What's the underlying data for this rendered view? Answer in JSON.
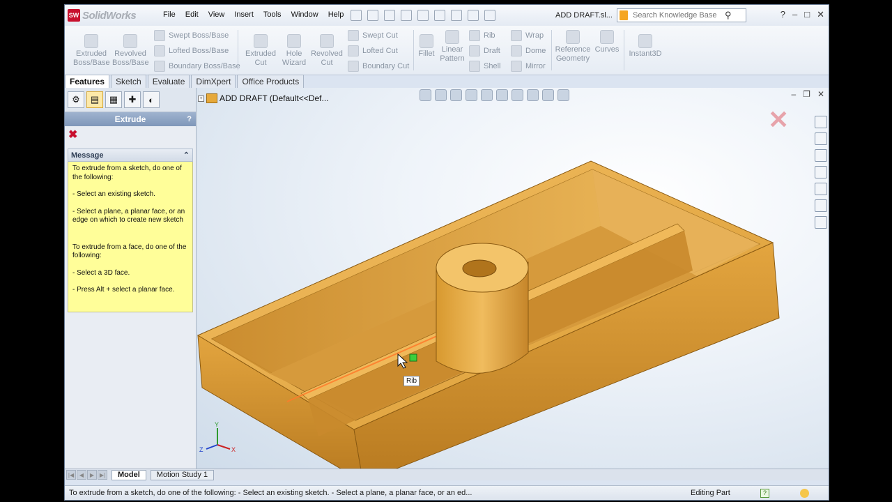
{
  "app": {
    "name": "SolidWorks",
    "badge": "SW"
  },
  "menu": [
    "File",
    "Edit",
    "View",
    "Insert",
    "Tools",
    "Window",
    "Help"
  ],
  "doc_title": "ADD DRAFT.sl...",
  "search": {
    "placeholder": "Search Knowledge Base"
  },
  "ribbon": {
    "extruded_boss": "Extruded Boss/Base",
    "revolved_boss": "Revolved Boss/Base",
    "swept_boss": "Swept Boss/Base",
    "lofted_boss": "Lofted Boss/Base",
    "boundary_boss": "Boundary Boss/Base",
    "extruded_cut": "Extruded Cut",
    "hole_wizard": "Hole Wizard",
    "revolved_cut": "Revolved Cut",
    "swept_cut": "Swept Cut",
    "lofted_cut": "Lofted Cut",
    "boundary_cut": "Boundary Cut",
    "fillet": "Fillet",
    "linear_pattern": "Linear Pattern",
    "rib": "Rib",
    "draft": "Draft",
    "shell": "Shell",
    "wrap": "Wrap",
    "dome": "Dome",
    "mirror": "Mirror",
    "reference_geometry": "Reference Geometry",
    "curves": "Curves",
    "instant3d": "Instant3D"
  },
  "tabs": [
    "Features",
    "Sketch",
    "Evaluate",
    "DimXpert",
    "Office Products"
  ],
  "property_manager": {
    "title": "Extrude",
    "help": "?",
    "message_header": "Message",
    "message_lines": [
      "To extrude from a sketch, do one of the following:",
      "- Select an existing sketch.",
      "- Select a plane, a planar face, or an edge on which to create new sketch",
      "To extrude from a face, do one of the following:",
      "- Select a 3D face.",
      "- Press Alt + select a planar face."
    ]
  },
  "feature_tree": {
    "root": "ADD DRAFT  (Default<<Def..."
  },
  "tooltip": "Rib",
  "triad": {
    "y": "Y",
    "z": "Z",
    "x": "X"
  },
  "bottom_tabs": [
    "Model",
    "Motion Study 1"
  ],
  "status": {
    "message": "To extrude from a sketch, do one of the following:  - Select an existing sketch.  - Select a plane, a planar face, or an ed...",
    "mode": "Editing Part"
  },
  "colors": {
    "part": "#e0a037",
    "part_dark": "#a86e18",
    "highlight": "#ff7a2a"
  }
}
